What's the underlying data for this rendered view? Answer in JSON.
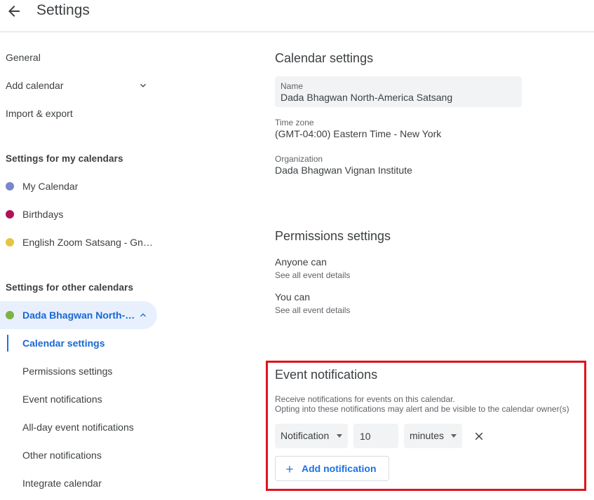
{
  "header": {
    "title": "Settings"
  },
  "sidebar": {
    "general": "General",
    "add_calendar": "Add calendar",
    "import_export": "Import & export",
    "my_calendars_title": "Settings for my calendars",
    "my_calendars": [
      {
        "label": "My Calendar",
        "color": "#7986cb"
      },
      {
        "label": "Birthdays",
        "color": "#ad1457"
      },
      {
        "label": "English Zoom Satsang - Gna…",
        "color": "#e4c441"
      }
    ],
    "other_calendars_title": "Settings for other calendars",
    "other_calendar": {
      "label": "Dada Bhagwan North-…",
      "color": "#7cb342"
    },
    "sub_items": [
      "Calendar settings",
      "Permissions settings",
      "Event notifications",
      "All-day event notifications",
      "Other notifications",
      "Integrate calendar"
    ]
  },
  "calendar_settings": {
    "title": "Calendar settings",
    "name_label": "Name",
    "name_value": "Dada Bhagwan North-America Satsang",
    "timezone_label": "Time zone",
    "timezone_value": "(GMT-04:00) Eastern Time - New York",
    "org_label": "Organization",
    "org_value": "Dada Bhagwan Vignan Institute"
  },
  "permissions": {
    "title": "Permissions settings",
    "anyone_label": "Anyone can",
    "anyone_value": "See all event details",
    "you_label": "You can",
    "you_value": "See all event details"
  },
  "event_notifications": {
    "title": "Event notifications",
    "desc_line1": "Receive notifications for events on this calendar.",
    "desc_line2": "Opting into these notifications may alert and be visible to the calendar owner(s)",
    "type_value": "Notification",
    "amount_value": "10",
    "unit_value": "minutes",
    "add_label": "Add notification"
  },
  "colors": {
    "accent": "#1a73e8",
    "highlight_border": "#e0131d"
  }
}
